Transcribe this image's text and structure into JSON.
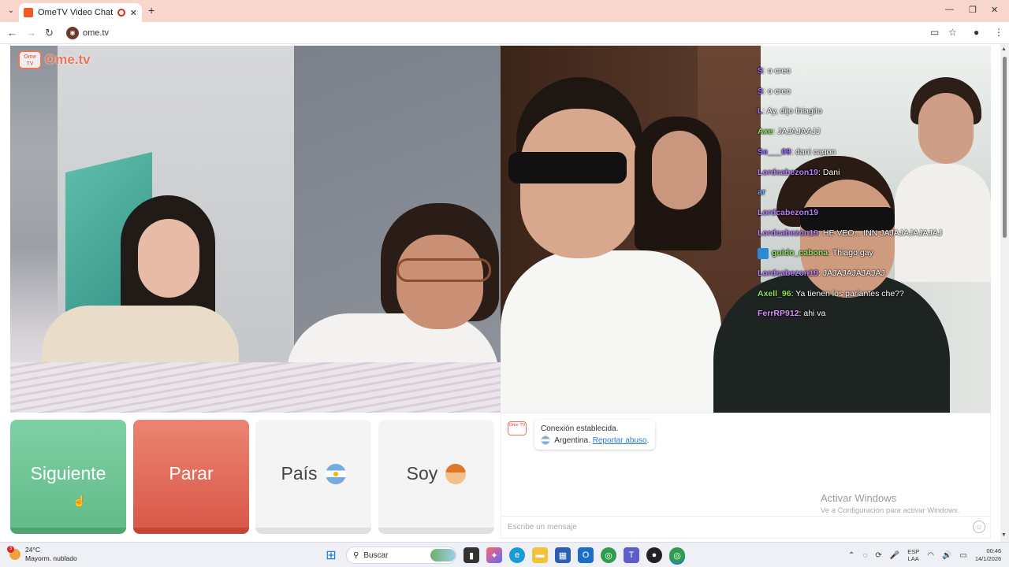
{
  "browser": {
    "tab_title": "OmeTV Video Chat — Ome",
    "new_tab": "+",
    "url": "ome.tv"
  },
  "logo": {
    "icon_text": "Ome TV",
    "text": "Ome.tv"
  },
  "overlay_chat": [
    {
      "user": "S",
      "user_color": "#9b6bff",
      "msg": "o creo"
    },
    {
      "user": "S",
      "user_color": "#9b6bff",
      "msg": "o creo"
    },
    {
      "user": "L",
      "user_color": "#9b6bff",
      "msg": "Ay, dijo thiagito"
    },
    {
      "user": "Axe",
      "user_color": "#8fe35a",
      "msg": "JAJAJAAJJ"
    },
    {
      "user": "Se___09",
      "user_color": "#9b6bff",
      "msg": "dani cagon"
    },
    {
      "user": "Lordcabezon19",
      "user_color": "#b57cff",
      "msg": "Dani"
    },
    {
      "user": "ar",
      "user_color": "#6ea8ff",
      "msg": ""
    },
    {
      "user": "Lordcabezon19",
      "user_color": "#b57cff",
      "msg": ""
    },
    {
      "user": "Lordcabezon19",
      "user_color": "#b57cff",
      "msg": "HE VEO... INN JAJAJAJAJAJAJ"
    },
    {
      "user": "guido_cabona",
      "user_color": "#8fe35a",
      "msg": "Thiago gay",
      "badge": true
    },
    {
      "user": "Lordcabezon19",
      "user_color": "#b57cff",
      "msg": "JAJAJAJAJAJAJ"
    },
    {
      "user": "Axell_96",
      "user_color": "#8fe35a",
      "msg": "Ya tienen los parlantes che??"
    },
    {
      "user": "FerrRP912",
      "user_color": "#d98cff",
      "msg": "ahi va"
    }
  ],
  "controls": {
    "next_label": "Siguiente",
    "stop_label": "Parar",
    "country_label": "País",
    "gender_label": "Soy"
  },
  "chat": {
    "logo_text": "Ome TV",
    "connected": "Conexión establecida.",
    "country": "Argentina.",
    "report": "Reportar abuso",
    "report_suffix": ".",
    "input_placeholder": "Escribe un mensaje",
    "watermark_title": "Activar Windows",
    "watermark_sub": "Ve a Configuración para activar Windows."
  },
  "taskbar": {
    "weather_temp": "24°C",
    "weather_desc": "Mayorm. nublado",
    "weather_badge": "3",
    "search_label": "Buscar",
    "lang_1": "ESP",
    "lang_2": "LAA",
    "time": "00:46",
    "date": "14/1/2026"
  },
  "colors": {
    "accent": "#e9765a",
    "next": "#6cc493",
    "stop": "#e06a58"
  }
}
